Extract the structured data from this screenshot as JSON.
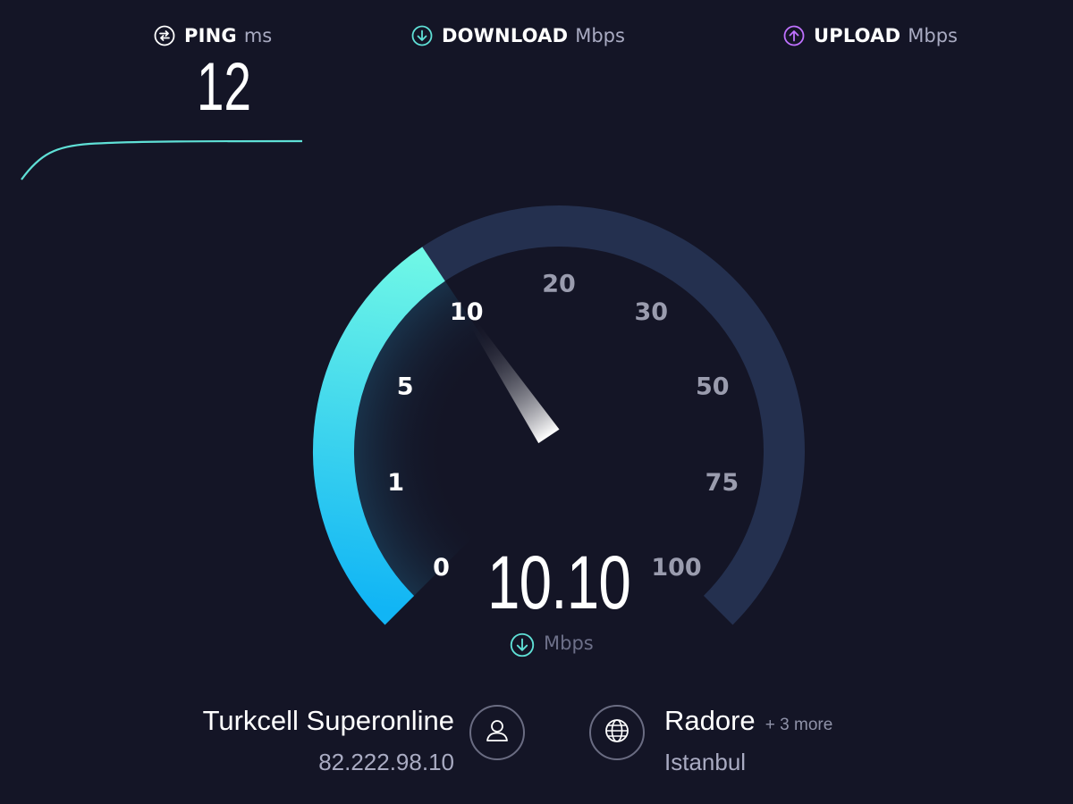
{
  "metrics": {
    "ping": {
      "label": "PING",
      "unit": "ms",
      "value": "12",
      "icon": "ping-icon",
      "color": "#ffffff"
    },
    "download": {
      "label": "DOWNLOAD",
      "unit": "Mbps",
      "icon": "download-arrow-icon",
      "color": "#5fe0d6"
    },
    "upload": {
      "label": "UPLOAD",
      "unit": "Mbps",
      "icon": "upload-arrow-icon",
      "color": "#bf71ff"
    }
  },
  "gauge": {
    "ticks": [
      "0",
      "1",
      "5",
      "10",
      "20",
      "30",
      "50",
      "75",
      "100"
    ],
    "current_tick_fraction": 0.375,
    "value": "10.10",
    "unit": "Mbps",
    "unit_icon": "download-arrow-icon",
    "colors": {
      "track": "#24304f",
      "fill_start": "#11b5f5",
      "fill_end": "#6ff7e6",
      "active_label": "#ffffff",
      "inactive_label": "#9a9cae"
    }
  },
  "isp": {
    "name": "Turkcell Superonline",
    "ip": "82.222.98.10",
    "icon": "user-icon"
  },
  "server": {
    "name": "Radore",
    "more": "+ 3 more",
    "location": "Istanbul",
    "icon": "globe-icon"
  }
}
